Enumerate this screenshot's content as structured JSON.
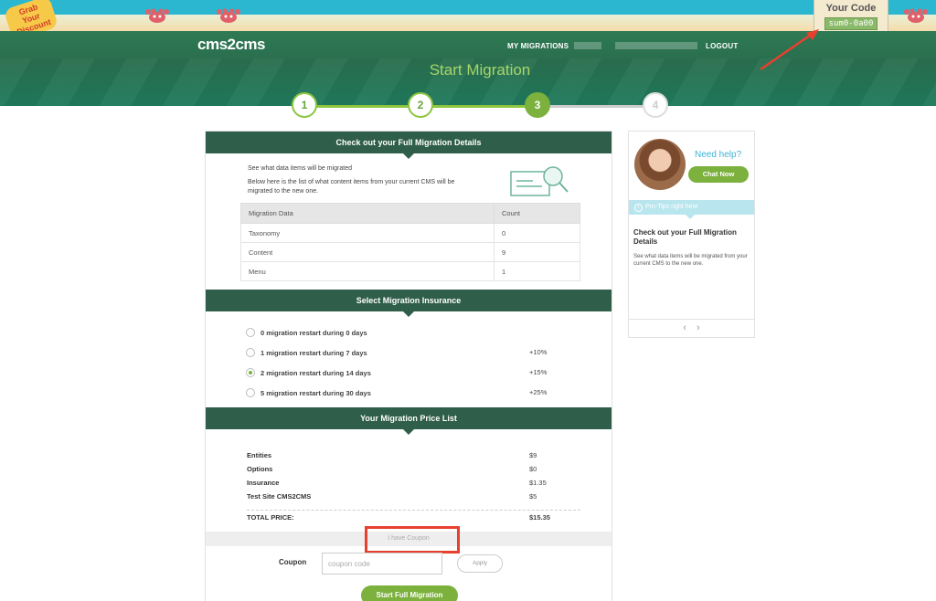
{
  "promo": {
    "badge_text": "Grab Your Discount",
    "code_title": "Your Code",
    "code_value": "sum0-0a00"
  },
  "header": {
    "brand": "cms2cms",
    "nav": {
      "my_migrations": "MY MIGRATIONS",
      "logout": "LOGOUT"
    },
    "page_title": "Start Migration"
  },
  "steps": [
    "1",
    "2",
    "3",
    "4"
  ],
  "details": {
    "heading": "Check out your Full Migration Details",
    "intro_title": "See what data items will be migrated",
    "intro_text": "Below here is the list of what content items from your current CMS will be migrated to the new one.",
    "table": {
      "headers": [
        "Migration Data",
        "Count"
      ],
      "rows": [
        [
          "Taxonomy",
          "0"
        ],
        [
          "Content",
          "9"
        ],
        [
          "Menu",
          "1"
        ]
      ]
    }
  },
  "insurance": {
    "heading": "Select Migration Insurance",
    "options": [
      {
        "label": "0 migration restart during 0 days",
        "price": ""
      },
      {
        "label": "1 migration restart during 7 days",
        "price": "+10%"
      },
      {
        "label": "2 migration restart during 14 days",
        "price": "+15%"
      },
      {
        "label": "5 migration restart during 30 days",
        "price": "+25%"
      }
    ],
    "selected_index": 2
  },
  "pricelist": {
    "heading": "Your Migration Price List",
    "rows": [
      {
        "label": "Entities",
        "value": "$9"
      },
      {
        "label": "Options",
        "value": "$0"
      },
      {
        "label": "Insurance",
        "value": "$1.35"
      },
      {
        "label": "Test Site CMS2CMS",
        "value": "$5"
      }
    ],
    "total_label": "TOTAL PRICE:",
    "total_value": "$15.35"
  },
  "coupon": {
    "toggle_label": "I have Coupon",
    "label": "Coupon",
    "placeholder": "coupon code",
    "apply_label": "Apply"
  },
  "start_button": "Start Full Migration",
  "help": {
    "need_help": "Need help?",
    "chat_button": "Chat Now",
    "pro_tips": "Pro-Tips right here",
    "tip_title": "Check out your Full Migration Details",
    "tip_text": "See what data items will be migrated from your current CMS to the new one.",
    "prev": "‹",
    "next": "›"
  },
  "colors": {
    "brand_green": "#2f5e4a",
    "accent_green": "#7bb13c",
    "help_blue": "#3fb3d6",
    "highlight_red": "#e8402f"
  }
}
